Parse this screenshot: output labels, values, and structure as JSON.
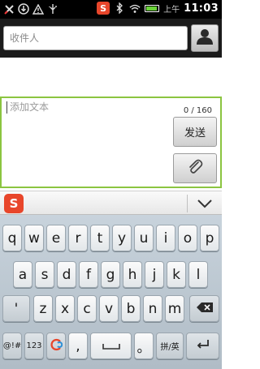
{
  "status_bar": {
    "left_icons": [
      "missed-call-icon",
      "download-icon",
      "warning-icon",
      "usb-icon"
    ],
    "sogou_label": "S",
    "noon_label": "上午",
    "time": "11:03",
    "battery_color": "#6ad339"
  },
  "recipient": {
    "placeholder": "收件人"
  },
  "compose": {
    "placeholder": "添加文本",
    "char_counter": "0 / 160",
    "send_label": "发送",
    "border_color": "#8bc540"
  },
  "ime": {
    "logo_label": "S",
    "collapse_icon": "chevron-down-icon"
  },
  "keyboard": {
    "row1": [
      "q",
      "w",
      "e",
      "r",
      "t",
      "y",
      "u",
      "i",
      "o",
      "p"
    ],
    "row2": [
      "a",
      "s",
      "d",
      "f",
      "g",
      "h",
      "j",
      "k",
      "l"
    ],
    "row3_first": "'",
    "row3": [
      "z",
      "x",
      "c",
      "v",
      "b",
      "n",
      "m"
    ],
    "row4": {
      "symbols": "@!#",
      "numbers": "123",
      "comma": ",",
      "period": "。",
      "lang": "拼/英"
    }
  }
}
